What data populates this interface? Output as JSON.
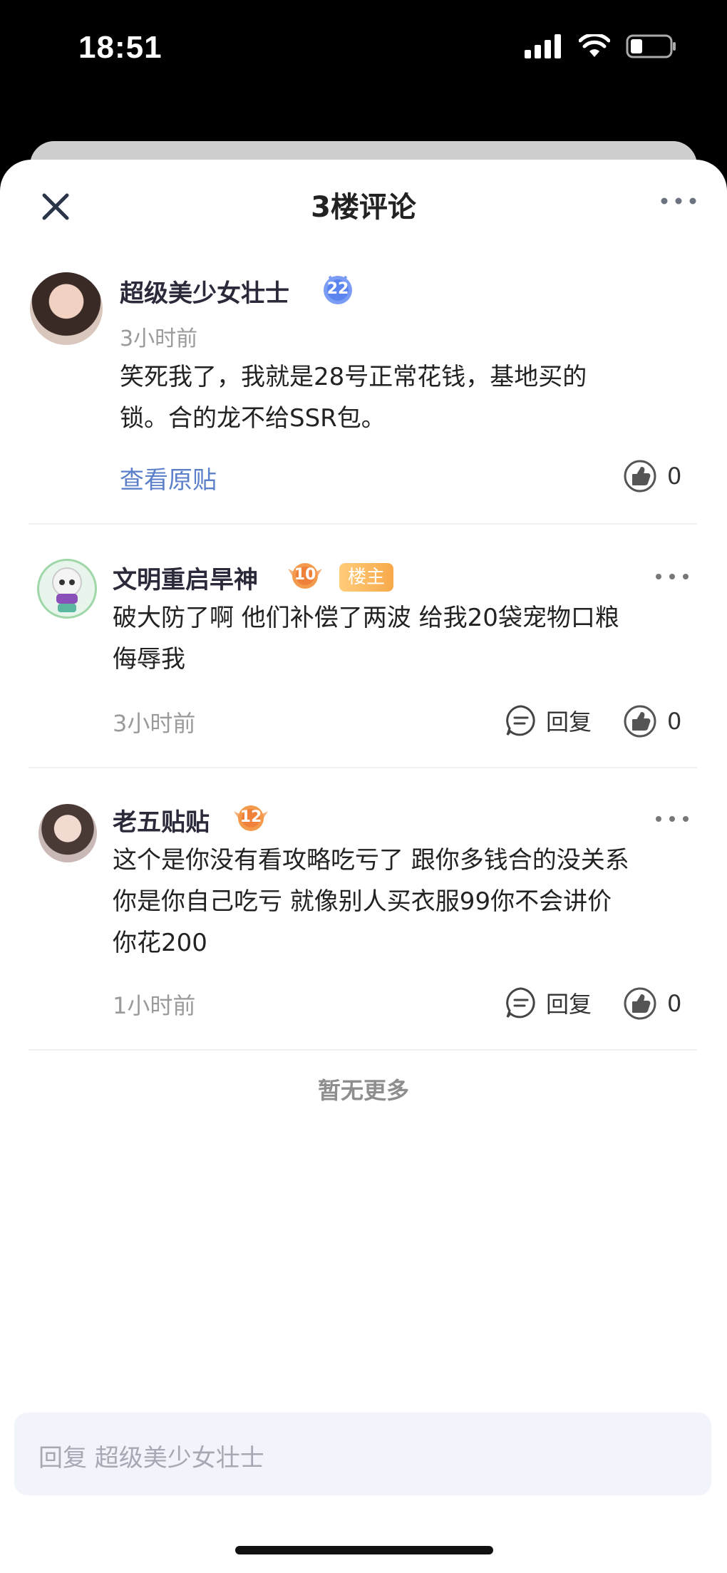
{
  "status": {
    "time": "18:51"
  },
  "header": {
    "title": "3楼评论"
  },
  "main_post": {
    "name": "超级美少女壮士",
    "level": "22",
    "time": "3小时前",
    "text": "笑死我了，我就是28号正常花钱，基地买的\n锁。合的龙不给SSR包。",
    "view_original": "查看原贴",
    "likes": "0"
  },
  "comments": [
    {
      "name": "文明重启旱神",
      "level": "10",
      "tag": "楼主",
      "text": "破大防了啊  他们补偿了两波  给我20袋宠物口粮\n侮辱我",
      "time": "3小时前",
      "reply_label": "回复",
      "likes": "0"
    },
    {
      "name": "老五贴贴",
      "level": "12",
      "text": "这个是你没有看攻略吃亏了 跟你多钱合的没关系\n你是你自己吃亏 就像别人买衣服99你不会讲价\n你花200",
      "time": "1小时前",
      "reply_label": "回复",
      "likes": "0"
    }
  ],
  "footer": {
    "no_more": "暂无更多"
  },
  "reply_input": {
    "placeholder": "回复 超级美少女壮士"
  },
  "colors": {
    "link": "#5b7fc9",
    "tag_host": "#f7a94a",
    "level_blue": "#6a8ff0",
    "level_orange": "#f39a4c"
  }
}
